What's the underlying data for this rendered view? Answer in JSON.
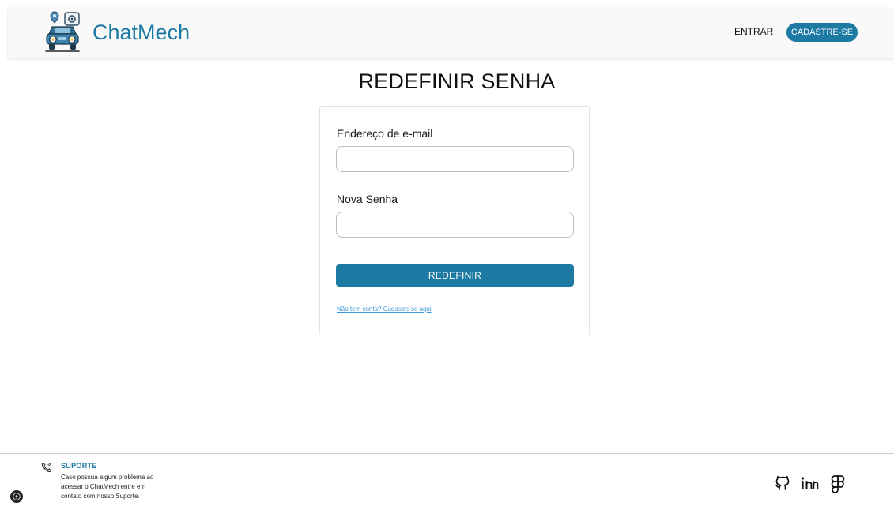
{
  "header": {
    "brand_name": "ChatMech",
    "nav_entrar": "ENTRAR",
    "nav_cadastre": "CADASTRE-SE"
  },
  "main": {
    "title": "REDEFINIR SENHA",
    "email_label": "Endereço de e-mail",
    "email_value": "",
    "password_label": "Nova Senha",
    "password_value": "",
    "submit_label": "REDEFINIR",
    "signup_link": "Não tem conta? Cadastre-se aqui"
  },
  "footer": {
    "support_title": "SUPORTE",
    "support_lines": [
      "Caso possua algum problema ao",
      "acessar o ChatMech entre em",
      "contato com nosso Suporte."
    ],
    "social_icons": [
      "github-icon",
      "linkedin-icon",
      "figma-icon"
    ]
  },
  "colors": {
    "accent": "#1d7aa3",
    "brand_text": "#1b7aa3",
    "link": "#3a9ad9",
    "header_bg": "#f9f9f9"
  }
}
